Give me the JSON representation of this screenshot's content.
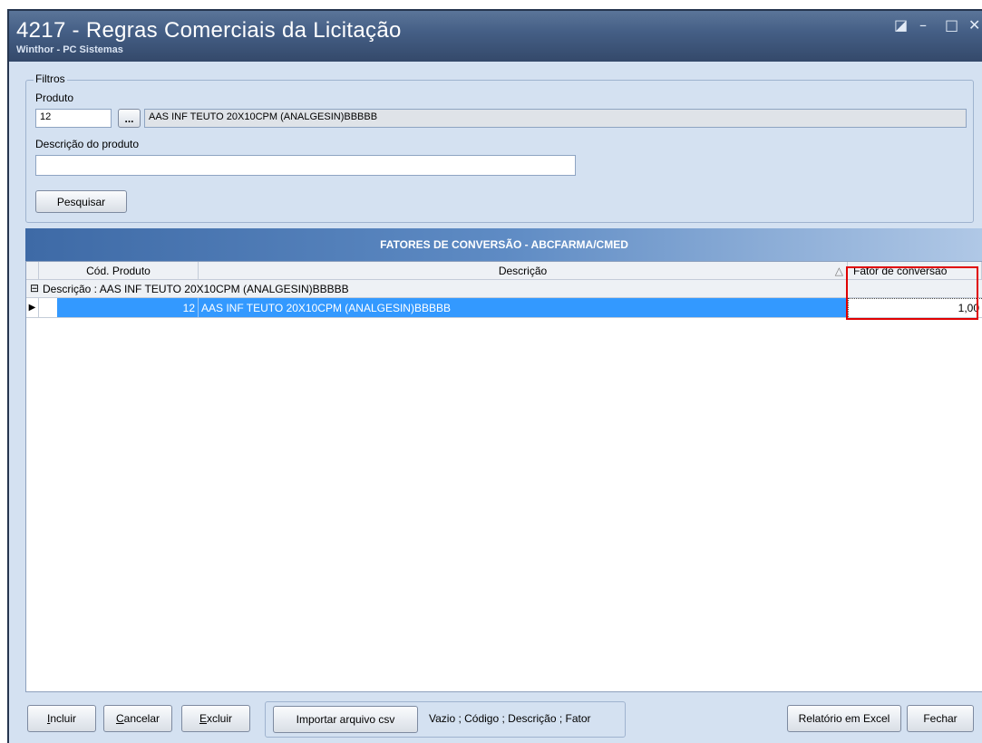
{
  "window": {
    "title": "4217 - Regras Comerciais da Licitação",
    "subtitle": "Winthor - PC Sistemas",
    "controls": {
      "restore": "◪",
      "minimize": "–",
      "maximize": "□",
      "close": "✕"
    }
  },
  "filters": {
    "legend": "Filtros",
    "produto_label": "Produto",
    "produto_code": "12",
    "lookup_button": "...",
    "produto_name": "AAS INF TEUTO 20X10CPM (ANALGESIN)BBBBB",
    "descricao_label": "Descrição do produto",
    "descricao_value": "",
    "search_button": "Pesquisar"
  },
  "grid": {
    "header_title": "FATORES DE CONVERSÃO - ABCFARMA/CMED",
    "columns": {
      "cod_produto": "Cód. Produto",
      "descricao": "Descrição",
      "sort_icon": "△",
      "fator": "Fator de conversão"
    },
    "group": {
      "expander": "⊟",
      "label": "Descrição : AAS INF TEUTO 20X10CPM (ANALGESIN)BBBBB"
    },
    "rows": [
      {
        "indicator": "▶",
        "cod_produto": "12",
        "descricao": "AAS INF TEUTO 20X10CPM (ANALGESIN)BBBBB",
        "fator": "1,00"
      }
    ]
  },
  "bottom": {
    "incluir": {
      "accel": "I",
      "rest": "ncluir"
    },
    "cancelar": {
      "accel": "C",
      "rest": "ancelar"
    },
    "excluir": {
      "accel": "E",
      "rest": "xcluir"
    },
    "importar_csv": "Importar arquivo csv",
    "csv_format_hint": "Vazio ; Código ; Descrição ; Fator",
    "relatorio_excel": "Relatório em Excel",
    "fechar": "Fechar"
  },
  "colors": {
    "selection": "#3399ff",
    "highlight_border": "#e00000"
  }
}
